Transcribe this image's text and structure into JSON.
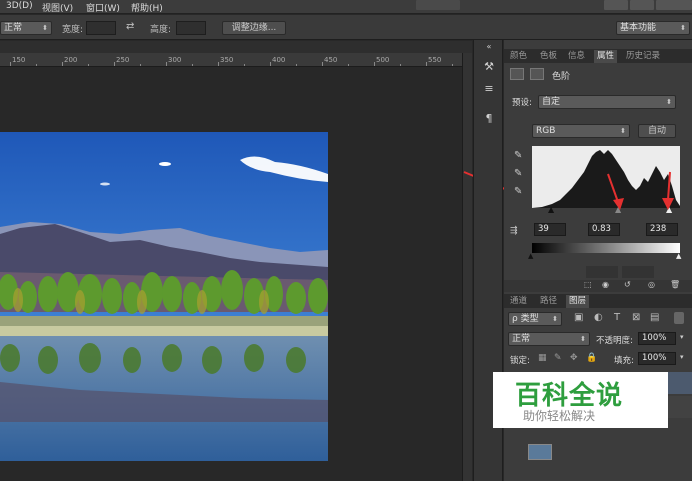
{
  "menubar": {
    "items": [
      "3D(D)",
      "视图(V)",
      "窗口(W)",
      "帮助(H)"
    ]
  },
  "options": {
    "mode_value": "正常",
    "width_label": "宽度:",
    "height_label": "高度:",
    "refine_edge_button": "调整边缘...",
    "workspace_value": "基本功能"
  },
  "ruler": {
    "ticks": [
      "150",
      "200",
      "250",
      "300",
      "350",
      "400",
      "450",
      "500",
      "550"
    ]
  },
  "panel_tabs_top": [
    "颜色",
    "色板",
    "信息",
    "属性",
    "历史记录"
  ],
  "properties": {
    "title": "色阶",
    "preset_label": "预设:",
    "preset_value": "自定",
    "channel_value": "RGB",
    "auto_button": "自动",
    "input_black": "39",
    "input_gray": "0.83",
    "input_white": "238"
  },
  "panel_tabs_bottom": [
    "通道",
    "路径",
    "图层"
  ],
  "layers": {
    "kind_value": "ρ 类型",
    "blend_value": "正常",
    "opacity_label": "不透明度:",
    "opacity_value": "100%",
    "lock_label": "锁定:",
    "fill_label": "填充:",
    "fill_value": "100%"
  },
  "watermark": {
    "title": "百科全说",
    "subtitle": "助你轻松解决"
  },
  "colors": {
    "accent": "#2e9e3e",
    "annotation_arrow": "#e53030"
  }
}
